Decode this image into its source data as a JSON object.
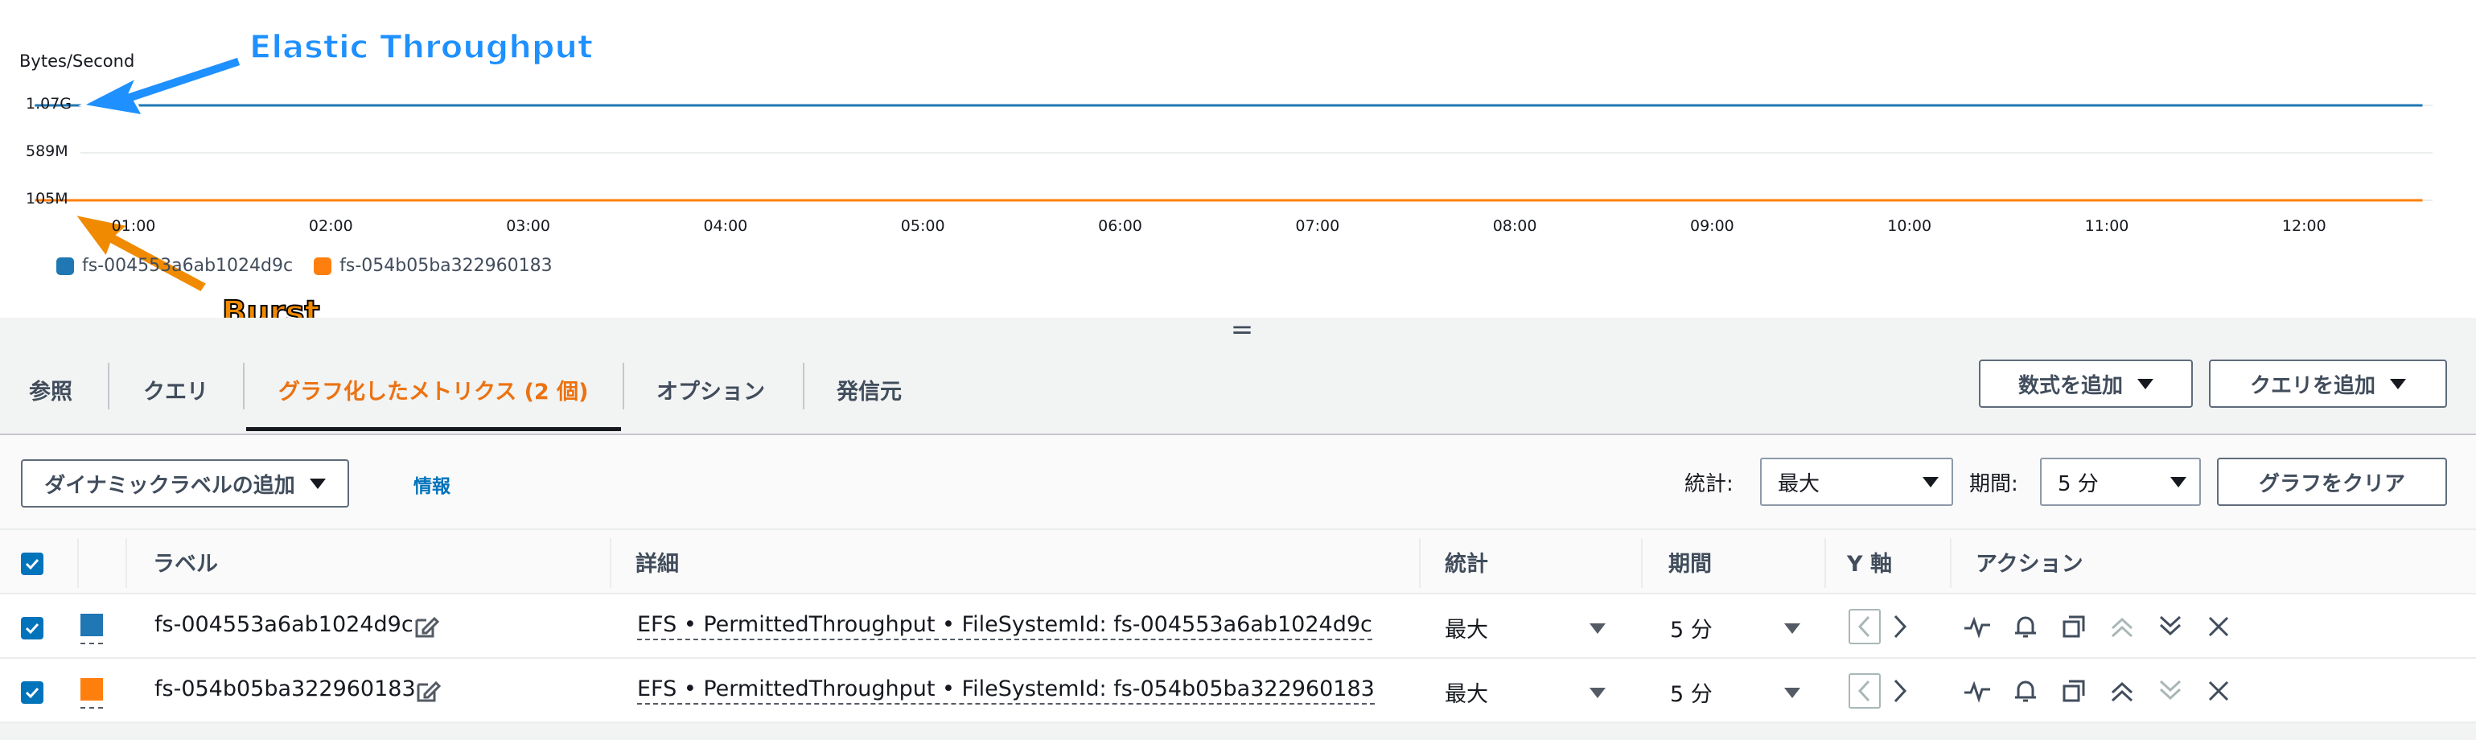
{
  "chart": {
    "unit_label": "Bytes/Second",
    "y_ticks": [
      "1.07G",
      "589M",
      "105M"
    ],
    "x_ticks": [
      "01:00",
      "02:00",
      "03:00",
      "04:00",
      "05:00",
      "06:00",
      "07:00",
      "08:00",
      "09:00",
      "10:00",
      "11:00",
      "12:00"
    ],
    "legend": [
      {
        "label": "fs-004553a6ab1024d9c",
        "color": "#1f77b4"
      },
      {
        "label": "fs-054b05ba322960183",
        "color": "#ff7f0e"
      }
    ],
    "annotations": {
      "elastic": "Elastic Throughput",
      "burst": "Burst"
    }
  },
  "chart_data": {
    "type": "line",
    "ylabel": "Bytes/Second",
    "y_ticks": [
      "105M",
      "589M",
      "1.07G"
    ],
    "x": [
      "00:30",
      "01:00",
      "02:00",
      "03:00",
      "04:00",
      "05:00",
      "06:00",
      "07:00",
      "08:00",
      "09:00",
      "10:00",
      "11:00",
      "12:00",
      "12:36"
    ],
    "series": [
      {
        "name": "fs-004553a6ab1024d9c",
        "values": [
          1.07,
          1.07,
          1.07,
          1.07,
          1.07,
          1.07,
          1.07,
          1.07,
          1.07,
          1.07,
          1.07,
          1.07,
          1.07,
          1.07
        ],
        "unit": "G",
        "color": "#1f77b4"
      },
      {
        "name": "fs-054b05ba322960183",
        "values": [
          0.105,
          0.105,
          0.105,
          0.105,
          0.105,
          0.105,
          0.105,
          0.105,
          0.105,
          0.105,
          0.105,
          0.105,
          0.105,
          0.105
        ],
        "unit": "G",
        "color": "#ff7f0e"
      }
    ],
    "grid": true,
    "legend_position": "bottom-left"
  },
  "handle": "=",
  "tabs": [
    {
      "label": "参照",
      "active": false
    },
    {
      "label": "クエリ",
      "active": false
    },
    {
      "label": "グラフ化したメトリクス (2 個)",
      "active": true
    },
    {
      "label": "オプション",
      "active": false
    },
    {
      "label": "発信元",
      "active": false
    }
  ],
  "tab_buttons": {
    "add_math": "数式を追加",
    "add_query": "クエリを追加"
  },
  "toolbar": {
    "dynamic_label": "ダイナミックラベルの追加",
    "info": "情報",
    "stat_label": "統計:",
    "stat_value": "最大",
    "period_label": "期間:",
    "period_value": "5 分",
    "clear_graph": "グラフをクリア"
  },
  "table": {
    "headers": {
      "label": "ラベル",
      "detail": "詳細",
      "stat": "統計",
      "period": "期間",
      "yaxis": "Y 軸",
      "actions": "アクション"
    },
    "rows": [
      {
        "label": "fs-004553a6ab1024d9c",
        "detail": "EFS • PermittedThroughput • FileSystemId: fs-004553a6ab1024d9c",
        "stat": "最大",
        "period": "5 分",
        "color": "#1f77b4"
      },
      {
        "label": "fs-054b05ba322960183",
        "detail": "EFS • PermittedThroughput • FileSystemId: fs-054b05ba322960183",
        "stat": "最大",
        "period": "5 分",
        "color": "#ff7f0e"
      }
    ]
  }
}
